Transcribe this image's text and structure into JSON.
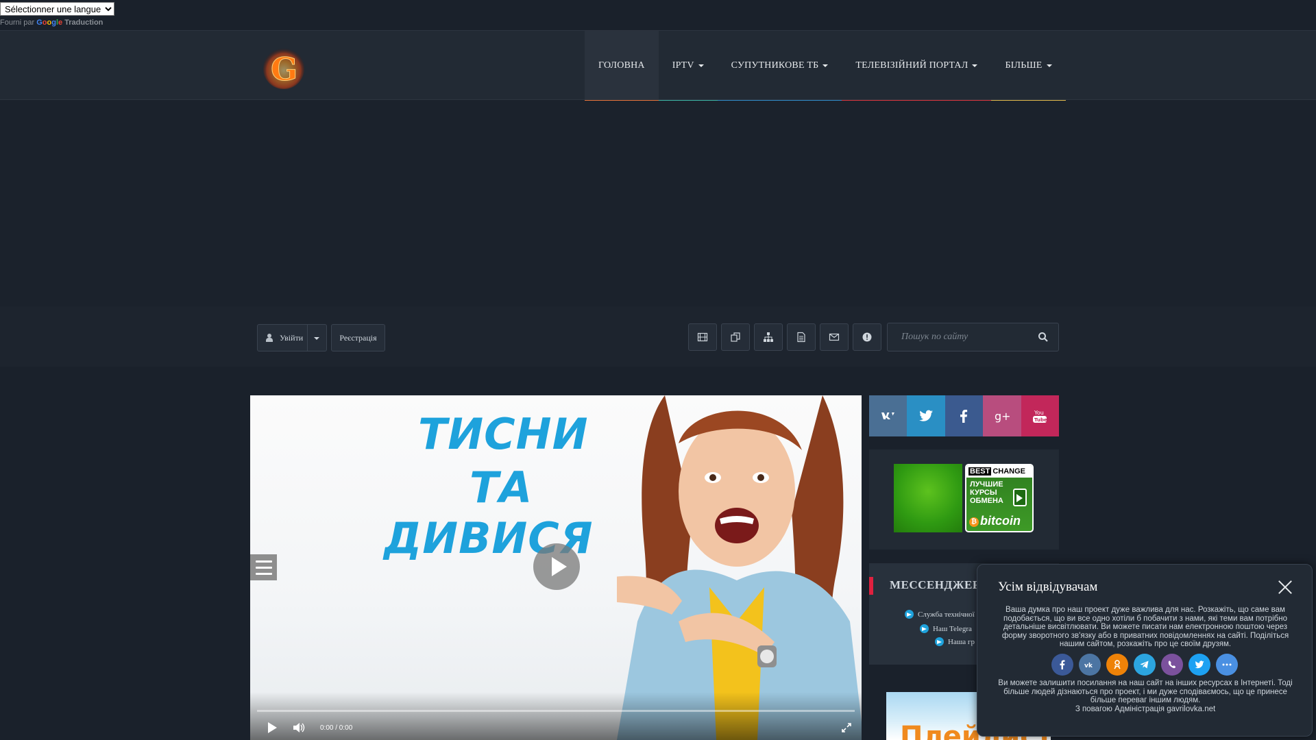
{
  "translate": {
    "select_label": "Sélectionner une langue",
    "powered_prefix": "Fourni par",
    "google": "Google",
    "translate_word": "Traduction"
  },
  "nav": {
    "items": [
      {
        "label": "ГОЛОВНА",
        "color": "#e8743b"
      },
      {
        "label": "IPTV",
        "color": "#3bb5a6"
      },
      {
        "label": "СУПУТНИКОВЕ ТБ",
        "color": "#2f8bc9"
      },
      {
        "label": "ТЕЛЕВІЗІЙНИЙ ПОРТАЛ",
        "color": "#d9353d"
      },
      {
        "label": "БІЛЬШЕ",
        "color": "#e0b84a"
      }
    ]
  },
  "toolbar": {
    "login_label": "Увійти",
    "register_label": "Реєстрація",
    "icons": [
      "film-icon",
      "copy-icon",
      "sitemap-icon",
      "document-icon",
      "envelope-icon",
      "info-icon"
    ],
    "search_placeholder": "Пошук по сайту"
  },
  "player": {
    "promo_lines": [
      "ТИСНИ",
      "ТА",
      "ДИВИСЯ"
    ],
    "time": "0:00",
    "duration": "/ 0:00"
  },
  "sidebar": {
    "social": [
      {
        "name": "vk-icon",
        "color": "#4a6f94"
      },
      {
        "name": "twitter-icon",
        "color": "#2a8fc4"
      },
      {
        "name": "facebook-icon",
        "color": "#3b5a8f"
      },
      {
        "name": "google-plus-icon",
        "color": "#b84d7e"
      },
      {
        "name": "youtube-icon",
        "color": "#c2275a"
      }
    ],
    "bestchange": {
      "best": "BEST",
      "change": "CHANGE",
      "text": "ЛУЧШИЕ КУРСЫ ОБМЕНА",
      "brand": "bitcoin"
    },
    "messengers": {
      "title": "МЕССЕНДЖЕР",
      "links": [
        "Служба технічної",
        "Наш Telegra",
        "Наша гр"
      ]
    },
    "playlist_text": "Плейлист"
  },
  "popup": {
    "title": "Усім відвідувачам",
    "text1": "Ваша думка про наш проект дуже важлива для нас. Розкажіть, що саме вам подобається, що ви все одно хотіли б побачити з нами, які теми вам потрібно детальніше висвітлювати. Ви можете писати нам електронною поштою через форму зворотного зв'язку або в приватних повідомленнях на сайті. Поділіться нашим сайтом, розкажіть про це своїм друзям.",
    "text2": "Ви можете залишити посилання на наш сайт на інших ресурсах в Інтернеті. Тоді більше людей дізнаються про проект, і ми дуже сподіваємось, що це принесе більше переваг іншим людям.",
    "text3": "З повагою Адміністрація gavrilovka.net",
    "share": [
      {
        "name": "facebook-share-icon",
        "color": "#3b5998"
      },
      {
        "name": "vk-share-icon",
        "color": "#4c75a3"
      },
      {
        "name": "odnoklassniki-share-icon",
        "color": "#ee8208"
      },
      {
        "name": "telegram-share-icon",
        "color": "#2ca5e0"
      },
      {
        "name": "viber-share-icon",
        "color": "#7b519d"
      },
      {
        "name": "twitter-share-icon",
        "color": "#1da1f2"
      },
      {
        "name": "more-share-icon",
        "color": "#4a90e2"
      }
    ]
  }
}
